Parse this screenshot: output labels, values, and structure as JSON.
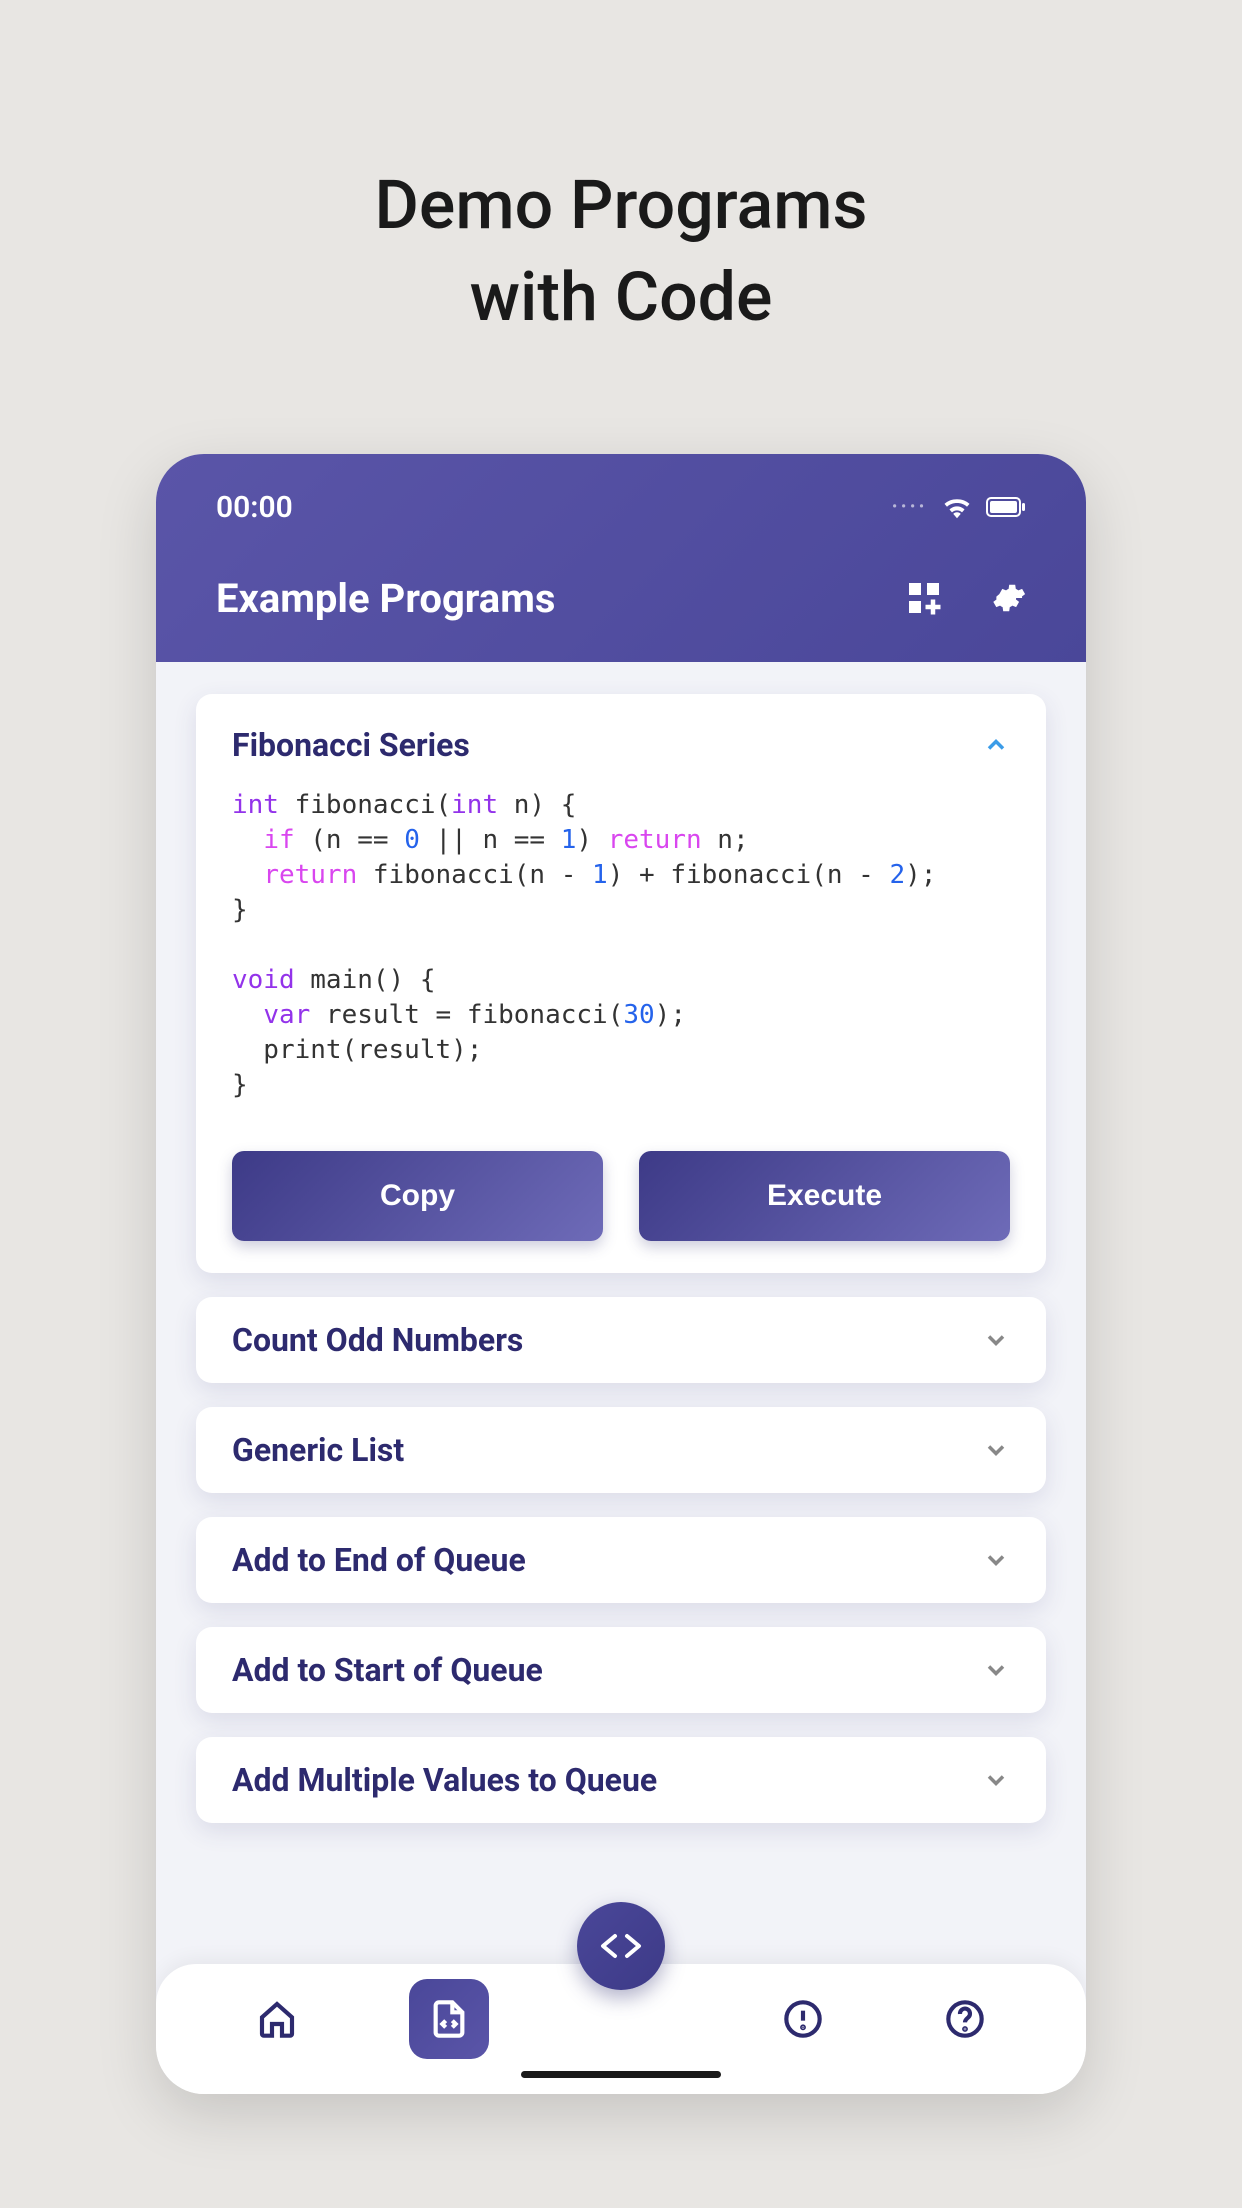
{
  "pageTitle": "Demo Programs\nwith Code",
  "statusBar": {
    "time": "00:00"
  },
  "header": {
    "title": "Example Programs"
  },
  "expandedCard": {
    "title": "Fibonacci Series",
    "copyLabel": "Copy",
    "executeLabel": "Execute",
    "code": {
      "text": "int fibonacci(int n) {\n  if (n == 0 || n == 1) return n;\n  return fibonacci(n - 1) + fibonacci(n - 2);\n}\n\nvoid main() {\n  var result = fibonacci(30);\n  print(result);\n}",
      "tokens": [
        {
          "t": "int",
          "c": "kw-type"
        },
        {
          "t": " fibonacci("
        },
        {
          "t": "int",
          "c": "kw-type"
        },
        {
          "t": " n) {\n  "
        },
        {
          "t": "if",
          "c": "kw-stmt"
        },
        {
          "t": " (n == "
        },
        {
          "t": "0",
          "c": "kw-num"
        },
        {
          "t": " || n == "
        },
        {
          "t": "1",
          "c": "kw-num"
        },
        {
          "t": ") "
        },
        {
          "t": "return",
          "c": "kw-stmt"
        },
        {
          "t": " n;\n  "
        },
        {
          "t": "return",
          "c": "kw-stmt"
        },
        {
          "t": " fibonacci(n - "
        },
        {
          "t": "1",
          "c": "kw-num"
        },
        {
          "t": ") + fibonacci(n - "
        },
        {
          "t": "2",
          "c": "kw-num"
        },
        {
          "t": ");\n}\n\n"
        },
        {
          "t": "void",
          "c": "kw-type"
        },
        {
          "t": " main() {\n  "
        },
        {
          "t": "var",
          "c": "kw-type"
        },
        {
          "t": " result = fibonacci("
        },
        {
          "t": "30",
          "c": "kw-num"
        },
        {
          "t": ");\n  print(result);\n}"
        }
      ]
    }
  },
  "collapsedCards": [
    {
      "title": "Count Odd Numbers"
    },
    {
      "title": "Generic List"
    },
    {
      "title": "Add to End of Queue"
    },
    {
      "title": "Add to Start of Queue"
    },
    {
      "title": "Add Multiple Values to Queue"
    }
  ]
}
